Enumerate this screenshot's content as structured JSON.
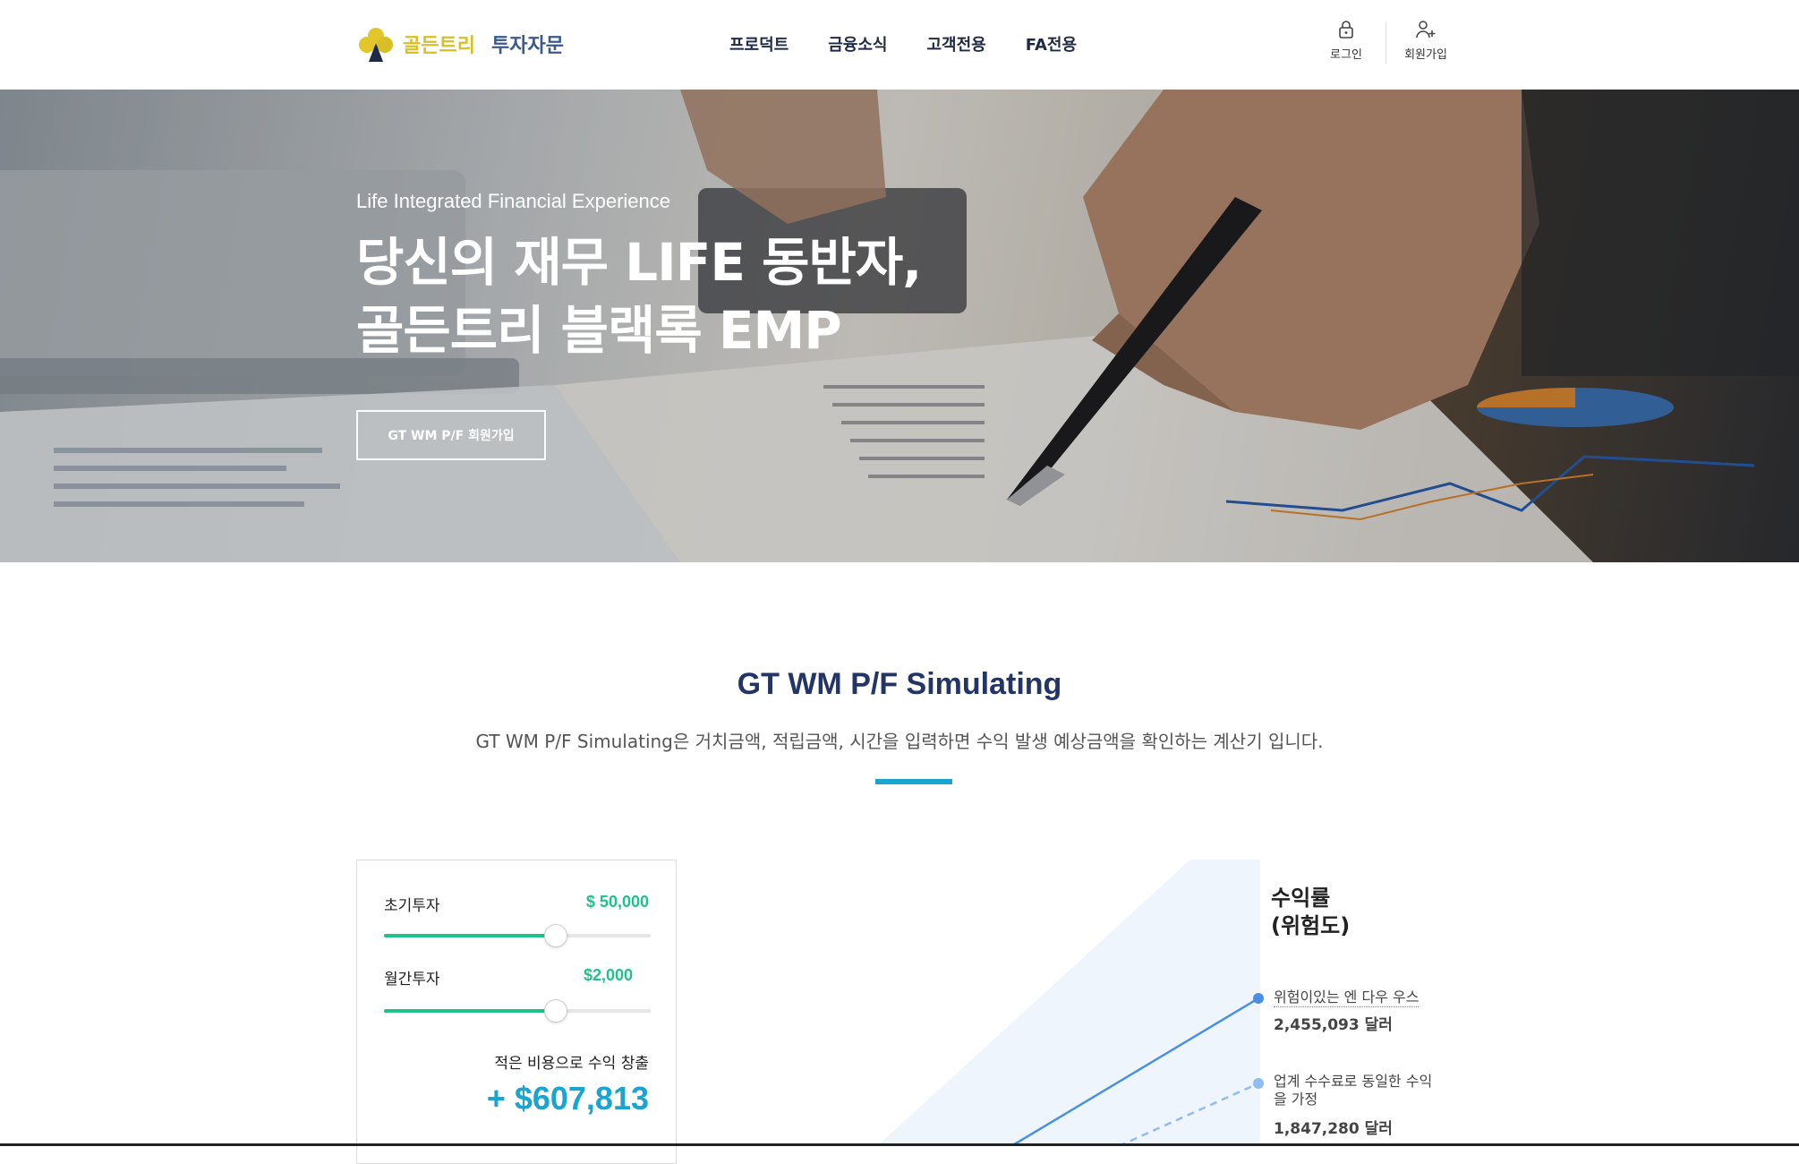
{
  "brand": {
    "name_part1": "골든트리",
    "name_part2": "투자자문"
  },
  "nav": {
    "items": [
      "프로덕트",
      "금융소식",
      "고객전용",
      "FA전용"
    ]
  },
  "user_menu": {
    "login_label": "로그인",
    "signup_label": "회원가입"
  },
  "hero": {
    "subtitle": "Life Integrated Financial Experience",
    "title_line1": "당신의 재무 LIFE 동반자,",
    "title_line2": "골든트리 블랙록 EMP",
    "button_label": "GT WM P/F 회원가입"
  },
  "simulating": {
    "title": "GT WM P/F Simulating",
    "description": "GT WM P/F Simulating은 거치금액, 적립금액, 시간을 입력하면 수익 발생 예상금액을 확인하는 계산기 입니다."
  },
  "calculator": {
    "initial_label": "초기투자",
    "initial_value": "$ 50,000",
    "initial_level": 0.64,
    "monthly_label": "월간투자",
    "monthly_value": "$2,000",
    "monthly_level": 0.64,
    "result_label": "적은 비용으로 수익 창출",
    "result_value": "+ $607,813"
  },
  "chart": {
    "title_line1": "수익률",
    "title_line2": "(위험도)",
    "legend": [
      {
        "label": "위험이있는 엔 다우 우스",
        "value": "2,455,093 달러"
      },
      {
        "label_line1": "업계 수수료로 동일한 수익",
        "label_line2": "을 가정",
        "value": "1,847,280 달러"
      }
    ],
    "colors": {
      "solid_line": "#4a90e2",
      "dashed_line": "#8fbcf2",
      "area": "#eef5fd"
    }
  }
}
